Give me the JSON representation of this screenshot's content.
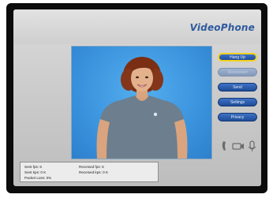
{
  "app": {
    "title": "VideoPhone"
  },
  "colors": {
    "title_text": "#2f5a9e",
    "button_fill": "#1e4c98",
    "active_highlight": "#f2d21e",
    "video_background": "#3b93dd"
  },
  "buttons": [
    {
      "label": "Hang Up",
      "state": "active"
    },
    {
      "label": "Disconnect",
      "state": "disabled"
    },
    {
      "label": "Send",
      "state": "enabled"
    },
    {
      "label": "Settings",
      "state": "enabled"
    },
    {
      "label": "Privacy",
      "state": "enabled"
    }
  ],
  "status_icons": [
    "phone-handset-icon",
    "camera-icon",
    "microphone-icon"
  ],
  "stats": {
    "sent_fps": "Sent fps: 6",
    "sent_kbps": "Sent kps: 0 K",
    "packet_loss": "Packet Loss: 0%",
    "received_fps": "Received fps: 6",
    "received_kbps": "Received kps: 0 K"
  }
}
